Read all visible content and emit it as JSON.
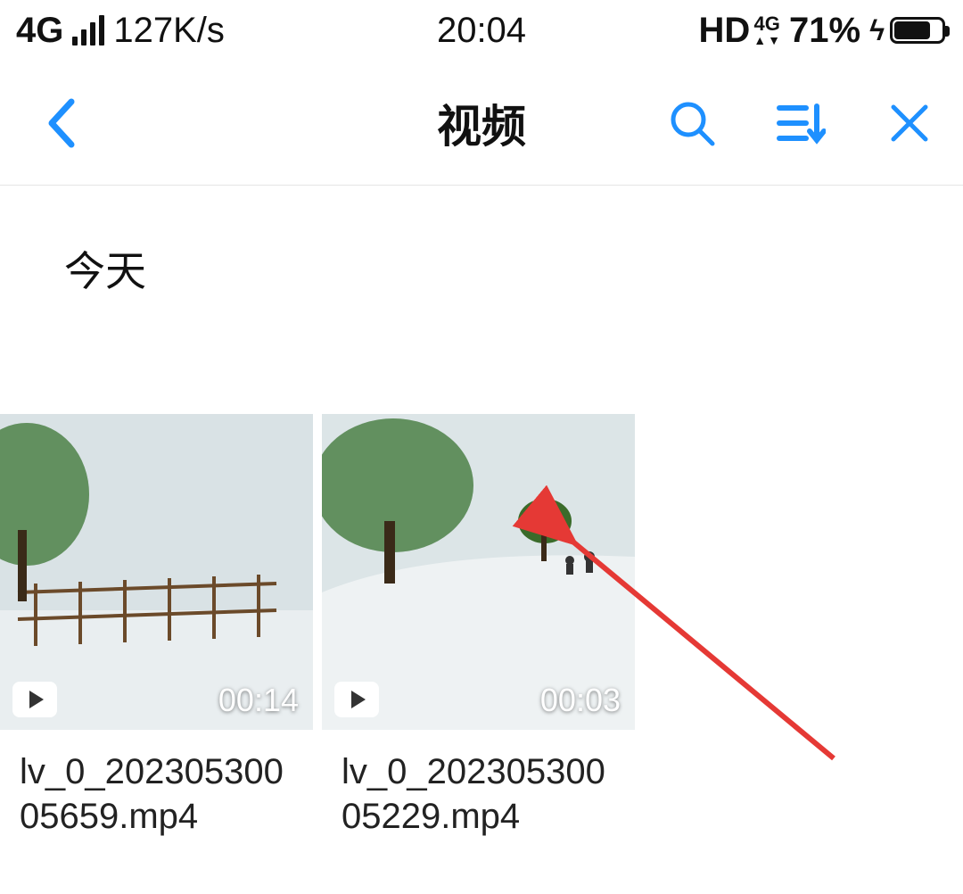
{
  "status_bar": {
    "network_type": "4G",
    "net_speed": "127K/s",
    "time": "20:04",
    "hd_label": "HD",
    "hd_sub": "4G",
    "battery_pct_text": "71%",
    "battery_fill_pct": 71
  },
  "app_bar": {
    "title": "视频"
  },
  "section": {
    "title": "今天"
  },
  "videos": [
    {
      "duration": "00:14",
      "filename": "lv_0_20230530005659.mp4"
    },
    {
      "duration": "00:03",
      "filename": "lv_0_20230530005229.mp4"
    }
  ]
}
